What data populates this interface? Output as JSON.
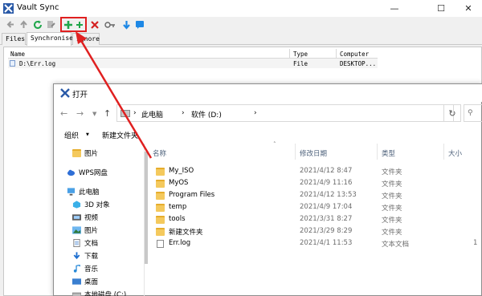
{
  "colors": {
    "highlight_red": "#e02020",
    "folder_yellow": "#f4c95d",
    "header_text": "#4c607a",
    "add_green": "#1fa64a",
    "delete_red": "#d42020",
    "toolbar_blue": "#1e88e5"
  },
  "vault": {
    "title": "Vault Sync",
    "toolbar_icons": [
      "back-arrow-icon",
      "up-arrow-icon",
      "refresh-icon",
      "edit-icon",
      "add-folder-icon",
      "add-file-icon",
      "delete-icon",
      "key-icon",
      "download-icon",
      "help-icon"
    ],
    "tabs": [
      "Files",
      "Synchronise",
      "Ignore"
    ],
    "table": {
      "headers": [
        "Name",
        "Type",
        "Computer"
      ],
      "rows": [
        {
          "name": "D:\\Err.log",
          "type": "File",
          "computer": "DESKTOP..."
        }
      ]
    }
  },
  "dialog": {
    "title": "打开",
    "breadcrumb": [
      "此电脑",
      "软件 (D:)"
    ],
    "organize": "组织",
    "new_folder": "新建文件夹",
    "sidebar": [
      {
        "label": "图片",
        "icon": "folder-icon"
      },
      {
        "label": "WPS网盘",
        "icon": "cloud-icon"
      },
      {
        "label": "此电脑",
        "icon": "computer-icon"
      },
      {
        "label": "3D 对象",
        "icon": "3d-objects-icon"
      },
      {
        "label": "视频",
        "icon": "video-icon"
      },
      {
        "label": "图片",
        "icon": "pictures-icon"
      },
      {
        "label": "文档",
        "icon": "documents-icon"
      },
      {
        "label": "下载",
        "icon": "download-icon"
      },
      {
        "label": "音乐",
        "icon": "music-icon"
      },
      {
        "label": "桌面",
        "icon": "desktop-icon"
      },
      {
        "label": "本地磁盘 (C:)",
        "icon": "drive-icon"
      }
    ],
    "columns": [
      "名称",
      "修改日期",
      "类型",
      "大小"
    ],
    "files": [
      {
        "name": "My_ISO",
        "date": "2021/4/12 8:47",
        "type": "文件夹",
        "size": "",
        "icon": "folder-icon"
      },
      {
        "name": "MyOS",
        "date": "2021/4/9 11:16",
        "type": "文件夹",
        "size": "",
        "icon": "folder-icon"
      },
      {
        "name": "Program Files",
        "date": "2021/4/12 13:53",
        "type": "文件夹",
        "size": "",
        "icon": "folder-icon"
      },
      {
        "name": "temp",
        "date": "2021/4/9 17:04",
        "type": "文件夹",
        "size": "",
        "icon": "folder-icon"
      },
      {
        "name": "tools",
        "date": "2021/3/31 8:27",
        "type": "文件夹",
        "size": "",
        "icon": "folder-icon"
      },
      {
        "name": "新建文件夹",
        "date": "2021/3/29 8:29",
        "type": "文件夹",
        "size": "",
        "icon": "folder-icon"
      },
      {
        "name": "Err.log",
        "date": "2021/4/1 11:53",
        "type": "文本文档",
        "size": "1",
        "icon": "text-file-icon"
      }
    ]
  }
}
